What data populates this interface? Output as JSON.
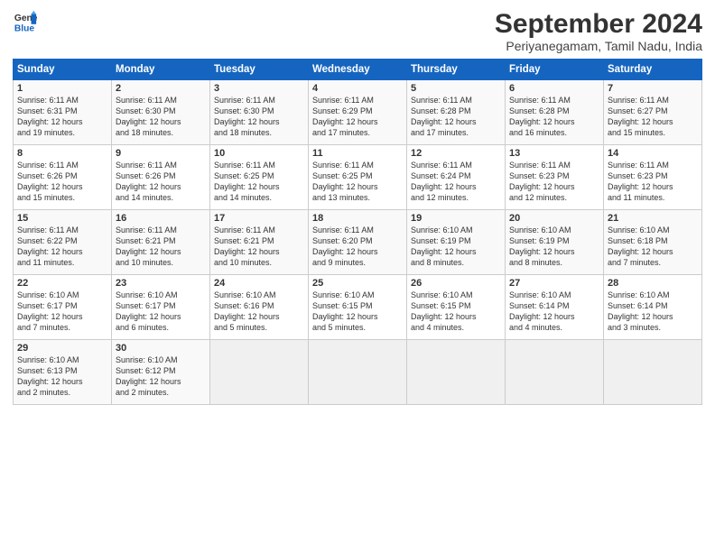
{
  "logo": {
    "line1": "General",
    "line2": "Blue"
  },
  "title": "September 2024",
  "subtitle": "Periyanegamam, Tamil Nadu, India",
  "days_of_week": [
    "Sunday",
    "Monday",
    "Tuesday",
    "Wednesday",
    "Thursday",
    "Friday",
    "Saturday"
  ],
  "weeks": [
    [
      {
        "num": "1",
        "lines": [
          "Sunrise: 6:11 AM",
          "Sunset: 6:31 PM",
          "Daylight: 12 hours",
          "and 19 minutes."
        ]
      },
      {
        "num": "2",
        "lines": [
          "Sunrise: 6:11 AM",
          "Sunset: 6:30 PM",
          "Daylight: 12 hours",
          "and 18 minutes."
        ]
      },
      {
        "num": "3",
        "lines": [
          "Sunrise: 6:11 AM",
          "Sunset: 6:30 PM",
          "Daylight: 12 hours",
          "and 18 minutes."
        ]
      },
      {
        "num": "4",
        "lines": [
          "Sunrise: 6:11 AM",
          "Sunset: 6:29 PM",
          "Daylight: 12 hours",
          "and 17 minutes."
        ]
      },
      {
        "num": "5",
        "lines": [
          "Sunrise: 6:11 AM",
          "Sunset: 6:28 PM",
          "Daylight: 12 hours",
          "and 17 minutes."
        ]
      },
      {
        "num": "6",
        "lines": [
          "Sunrise: 6:11 AM",
          "Sunset: 6:28 PM",
          "Daylight: 12 hours",
          "and 16 minutes."
        ]
      },
      {
        "num": "7",
        "lines": [
          "Sunrise: 6:11 AM",
          "Sunset: 6:27 PM",
          "Daylight: 12 hours",
          "and 15 minutes."
        ]
      }
    ],
    [
      {
        "num": "8",
        "lines": [
          "Sunrise: 6:11 AM",
          "Sunset: 6:26 PM",
          "Daylight: 12 hours",
          "and 15 minutes."
        ]
      },
      {
        "num": "9",
        "lines": [
          "Sunrise: 6:11 AM",
          "Sunset: 6:26 PM",
          "Daylight: 12 hours",
          "and 14 minutes."
        ]
      },
      {
        "num": "10",
        "lines": [
          "Sunrise: 6:11 AM",
          "Sunset: 6:25 PM",
          "Daylight: 12 hours",
          "and 14 minutes."
        ]
      },
      {
        "num": "11",
        "lines": [
          "Sunrise: 6:11 AM",
          "Sunset: 6:25 PM",
          "Daylight: 12 hours",
          "and 13 minutes."
        ]
      },
      {
        "num": "12",
        "lines": [
          "Sunrise: 6:11 AM",
          "Sunset: 6:24 PM",
          "Daylight: 12 hours",
          "and 12 minutes."
        ]
      },
      {
        "num": "13",
        "lines": [
          "Sunrise: 6:11 AM",
          "Sunset: 6:23 PM",
          "Daylight: 12 hours",
          "and 12 minutes."
        ]
      },
      {
        "num": "14",
        "lines": [
          "Sunrise: 6:11 AM",
          "Sunset: 6:23 PM",
          "Daylight: 12 hours",
          "and 11 minutes."
        ]
      }
    ],
    [
      {
        "num": "15",
        "lines": [
          "Sunrise: 6:11 AM",
          "Sunset: 6:22 PM",
          "Daylight: 12 hours",
          "and 11 minutes."
        ]
      },
      {
        "num": "16",
        "lines": [
          "Sunrise: 6:11 AM",
          "Sunset: 6:21 PM",
          "Daylight: 12 hours",
          "and 10 minutes."
        ]
      },
      {
        "num": "17",
        "lines": [
          "Sunrise: 6:11 AM",
          "Sunset: 6:21 PM",
          "Daylight: 12 hours",
          "and 10 minutes."
        ]
      },
      {
        "num": "18",
        "lines": [
          "Sunrise: 6:11 AM",
          "Sunset: 6:20 PM",
          "Daylight: 12 hours",
          "and 9 minutes."
        ]
      },
      {
        "num": "19",
        "lines": [
          "Sunrise: 6:10 AM",
          "Sunset: 6:19 PM",
          "Daylight: 12 hours",
          "and 8 minutes."
        ]
      },
      {
        "num": "20",
        "lines": [
          "Sunrise: 6:10 AM",
          "Sunset: 6:19 PM",
          "Daylight: 12 hours",
          "and 8 minutes."
        ]
      },
      {
        "num": "21",
        "lines": [
          "Sunrise: 6:10 AM",
          "Sunset: 6:18 PM",
          "Daylight: 12 hours",
          "and 7 minutes."
        ]
      }
    ],
    [
      {
        "num": "22",
        "lines": [
          "Sunrise: 6:10 AM",
          "Sunset: 6:17 PM",
          "Daylight: 12 hours",
          "and 7 minutes."
        ]
      },
      {
        "num": "23",
        "lines": [
          "Sunrise: 6:10 AM",
          "Sunset: 6:17 PM",
          "Daylight: 12 hours",
          "and 6 minutes."
        ]
      },
      {
        "num": "24",
        "lines": [
          "Sunrise: 6:10 AM",
          "Sunset: 6:16 PM",
          "Daylight: 12 hours",
          "and 5 minutes."
        ]
      },
      {
        "num": "25",
        "lines": [
          "Sunrise: 6:10 AM",
          "Sunset: 6:15 PM",
          "Daylight: 12 hours",
          "and 5 minutes."
        ]
      },
      {
        "num": "26",
        "lines": [
          "Sunrise: 6:10 AM",
          "Sunset: 6:15 PM",
          "Daylight: 12 hours",
          "and 4 minutes."
        ]
      },
      {
        "num": "27",
        "lines": [
          "Sunrise: 6:10 AM",
          "Sunset: 6:14 PM",
          "Daylight: 12 hours",
          "and 4 minutes."
        ]
      },
      {
        "num": "28",
        "lines": [
          "Sunrise: 6:10 AM",
          "Sunset: 6:14 PM",
          "Daylight: 12 hours",
          "and 3 minutes."
        ]
      }
    ],
    [
      {
        "num": "29",
        "lines": [
          "Sunrise: 6:10 AM",
          "Sunset: 6:13 PM",
          "Daylight: 12 hours",
          "and 2 minutes."
        ]
      },
      {
        "num": "30",
        "lines": [
          "Sunrise: 6:10 AM",
          "Sunset: 6:12 PM",
          "Daylight: 12 hours",
          "and 2 minutes."
        ]
      },
      null,
      null,
      null,
      null,
      null
    ]
  ]
}
